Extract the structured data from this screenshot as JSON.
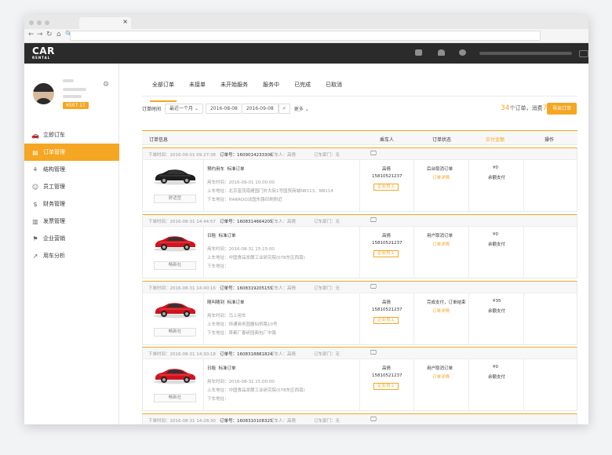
{
  "browser": {
    "tab_close": "×",
    "url": ""
  },
  "topnav": {
    "logo": "CAR",
    "logo_sub": "RENTAL"
  },
  "sidebar": {
    "money": "¥507.11",
    "items": [
      {
        "label": "立即订车",
        "icon": "car-icon",
        "glyph": "🚗"
      },
      {
        "label": "订单管理",
        "icon": "document-icon",
        "glyph": "▤"
      },
      {
        "label": "结构管理",
        "icon": "org-structure-icon",
        "glyph": "⚘"
      },
      {
        "label": "员工管理",
        "icon": "user-icon",
        "glyph": "☺"
      },
      {
        "label": "财务管理",
        "icon": "money-bag-icon",
        "glyph": "$"
      },
      {
        "label": "发票管理",
        "icon": "invoice-icon",
        "glyph": "▥"
      },
      {
        "label": "企业营销",
        "icon": "flag-icon",
        "glyph": "⚑"
      },
      {
        "label": "用车分析",
        "icon": "chart-line-icon",
        "glyph": "↗"
      }
    ]
  },
  "tabs": [
    "全部订单",
    "未接单",
    "未开始服务",
    "服务中",
    "已完成",
    "已取消"
  ],
  "filter": {
    "label": "订单时间",
    "range": "最近一个月",
    "start": "2016-08-08",
    "end": "2016-09-08",
    "more": "更多"
  },
  "summary": {
    "count": "34",
    "count_suffix": "个订单，消费",
    "amount": "77.63",
    "amount_suffix": "元",
    "export": "导出订单"
  },
  "table_headers": [
    "订单信息",
    "乘车人",
    "订单状态",
    "实付金额",
    "操作"
  ],
  "orders": [
    {
      "time": "下单时间：2016-09-01 09:27:38",
      "num": "订单号：1609014233306",
      "passenger_h": "订车人：高倩",
      "dept": "订车部门：无",
      "type": "预约用车",
      "type2": "标准订单",
      "use": "用车时间：2016-09-01 10:00:00",
      "from": "上车地址：北京富茂南建国门外大街1号国贸商城N8113、N8114",
      "to": "下车地址：HARROO法国东路印刷附近",
      "car": "舒适型",
      "name": "高倩",
      "phone": "15810521237",
      "tag": "企业员工",
      "status": "后台取消订单",
      "link": "订单详情",
      "price": "¥0",
      "pay": "余额支付",
      "img": "black"
    },
    {
      "time": "下单时间：2016-08-31 14:44:57",
      "num": "订单号：1608314664205",
      "passenger_h": "订车人：高倩",
      "dept": "订车部门：无",
      "type": "日租",
      "type2": "标准订单",
      "use": "用车时间：2016-08-31 15:15:00",
      "from": "上车地址：中国食品发酵工业研究院(078东区西南)",
      "to": "下车地址：",
      "car": "畅新社",
      "name": "高倩",
      "phone": "15810521237",
      "tag": "企业员工",
      "status": "用户取消订单",
      "link": "订单详情",
      "price": "¥0",
      "pay": "余额支付",
      "img": "red"
    },
    {
      "time": "下单时间：2016-08-31 14:40:16",
      "num": "订单号：1608319205155",
      "passenger_h": "订车人：高倩",
      "dept": "订车部门：无",
      "type": "随叫随到",
      "type2": "标准订单",
      "use": "用车时间：马上用车",
      "from": "上车地址：恒通商务园酱仙桥路10号",
      "to": "下车地址：首都厂春研园面包厂中路",
      "car": "畅新社",
      "name": "高倩",
      "phone": "15810521237",
      "tag": "企业员工",
      "status": "完成支付，订单结束",
      "link": "订单详情",
      "price": "¥35",
      "pay": "余额支付",
      "img": "red"
    },
    {
      "time": "下单时间：2016-08-31 14:30:18",
      "num": "订单号：1608318881824",
      "passenger_h": "订车人：高倩",
      "dept": "订车部门：无",
      "type": "日租",
      "type2": "标准订单",
      "use": "用车时间：2016-08-31 15:00:00",
      "from": "上车地址：中国食品发酵工业研究院(078东区西南)",
      "to": "下车地址：",
      "car": "畅新社",
      "name": "高倩",
      "phone": "15810521237",
      "tag": "企业员工",
      "status": "用户取消订单",
      "link": "订单详情",
      "price": "¥0",
      "pay": "余额支付",
      "img": "red"
    },
    {
      "time": "下单时间：2016-08-31 14:28:30",
      "num": "订单号：1608310108325",
      "passenger_h": "订车人：高倩",
      "dept": "订车部门：无"
    }
  ],
  "colors": {
    "accent": "#f5a623",
    "topbar": "#2b2b2b"
  }
}
